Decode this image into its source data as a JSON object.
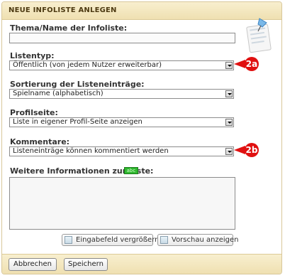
{
  "panel": {
    "title": "Neue Infoliste anlegen"
  },
  "fields": {
    "thema": {
      "label": "Thema/Name der Infoliste:",
      "value": ""
    },
    "listentyp": {
      "label": "Listentyp:",
      "value": "Öffentlich (von jedem Nutzer erweiterbar)"
    },
    "sortierung": {
      "label": "Sortierung der Listeneinträge:",
      "value": "Spielname (alphabetisch)"
    },
    "profilseite": {
      "label": "Profilseite:",
      "value": "Liste in eigener Profil-Seite anzeigen"
    },
    "kommentare": {
      "label": "Kommentare:",
      "value": "Listeneinträge können kommentiert werden"
    },
    "weitere": {
      "label": "Weitere Informationen zur Liste:",
      "value": "",
      "spell_badge": "abc"
    }
  },
  "textarea_buttons": {
    "enlarge": "Eingabefeld vergrößern",
    "preview": "Vorschau anzeigen"
  },
  "footer": {
    "cancel": "Abbrechen",
    "save": "Speichern"
  },
  "callouts": {
    "a": "2a",
    "b": "2b"
  },
  "colors": {
    "callout_red": "#e01010",
    "spell_green": "#2fb82f",
    "header_bg": "#f4e8c1"
  },
  "icons": {
    "decoration": "notepad-pushpin-icon",
    "enlarge": "enlarge-field-icon",
    "preview": "preview-icon"
  }
}
